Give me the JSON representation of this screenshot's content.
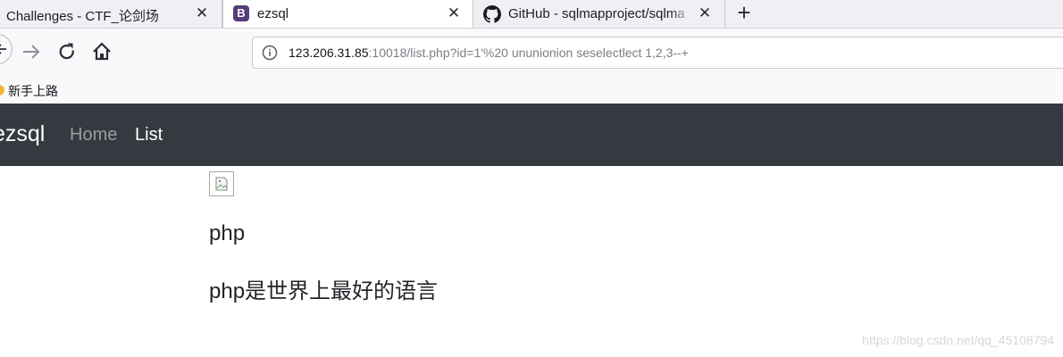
{
  "browser": {
    "tabs": [
      {
        "title": "Challenges - CTF_论剑场",
        "active": false
      },
      {
        "title": "ezsql",
        "active": true,
        "favicon_letter": "B"
      },
      {
        "title": "GitHub - sqlmapproject/sqlma",
        "active": false
      }
    ],
    "close_glyph": "✕",
    "new_tab_glyph": "+",
    "address": {
      "host": "123.206.31.85",
      "rest": ":10018/list.php?id=1'%20 ununionion seselectlect 1,2,3--+"
    },
    "bookmarks": [
      {
        "label": "新手上路"
      }
    ]
  },
  "app": {
    "brand": "ezsql",
    "nav": [
      {
        "label": "Home",
        "active": false
      },
      {
        "label": "List",
        "active": true
      }
    ]
  },
  "content": {
    "title": "php",
    "body": "php是世界上最好的语言"
  },
  "watermark": "https://blog.csdn.net/qq_45108794",
  "colors": {
    "navbar_bg": "#343a40",
    "bootstrap_purple": "#563d7c",
    "bookmark_icon": "#f3b531"
  }
}
